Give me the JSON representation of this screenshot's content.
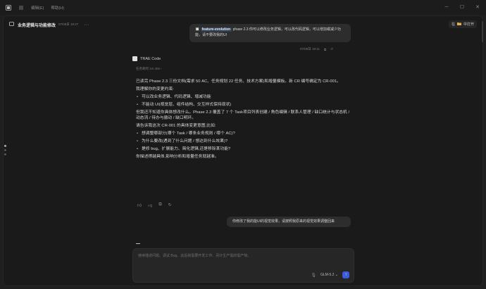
{
  "topbar": {
    "menu_edit": "编辑(E)",
    "menu_help": "帮助(H)"
  },
  "header": {
    "title": "业务逻辑与功能修改",
    "time": "07/08日 19:27",
    "more": "···",
    "mode_button": "在",
    "open_label": "中打开"
  },
  "user_message": {
    "tag": "feature-evolution",
    "text": " phase 2.3 你可以修改业务逻辑，可以改代码逻辑，可以增加或减少功能，请不要改我的UI",
    "meta_time": "07/08日 18:11"
  },
  "agent": {
    "name": "TRAE Code",
    "completed": "任务耗时 1m 46s ›"
  },
  "response": {
    "p1": "已读完 Phase 2.3 三份文档(需求 50 AC、任务规划 22 任务、技术方案)和增量模板。新 CR 编号确定为 CR-001。",
    "p2": "我理解你的变更约束:",
    "constraints": [
      "可以改业务逻辑、代码逻辑、增减功能",
      "不能动 UI(视觉层、组件结构、交互样式保持现状)"
    ],
    "p3": "但我还不知道你具体想改什么。Phase 2.3 覆盖了 7 个 Task项目列表创建 / 角色编辑 / 联系人管理 / 缺口统计与状态机 / 动态流 / 待办与撤动 / 缺口明环。",
    "p4": "请告诉我这次 CR-001 的具体变更意图,比如:",
    "questions": [
      "想调整哪部分(哪个 Task / 哪条业务规则 / 哪个 AC)?",
      "为什么要改(遇到了什么问题 / 想达到什么效果)?",
      "是修 bug、扩展能力、简化逻辑,还是移除某功能?"
    ],
    "p5": "你描述得越具体,影响分析和增量任务就越准。"
  },
  "user_message_2": {
    "text": "你修改了我的能UI的视觉效果，请按照我原来的视觉效果调整回来"
  },
  "input": {
    "placeholder": "继续描述问题、调试 Bug、此后我需要开发工作、另计生产需的需产物。",
    "model": "GLM-5.2 ⌄",
    "send": "↑"
  }
}
